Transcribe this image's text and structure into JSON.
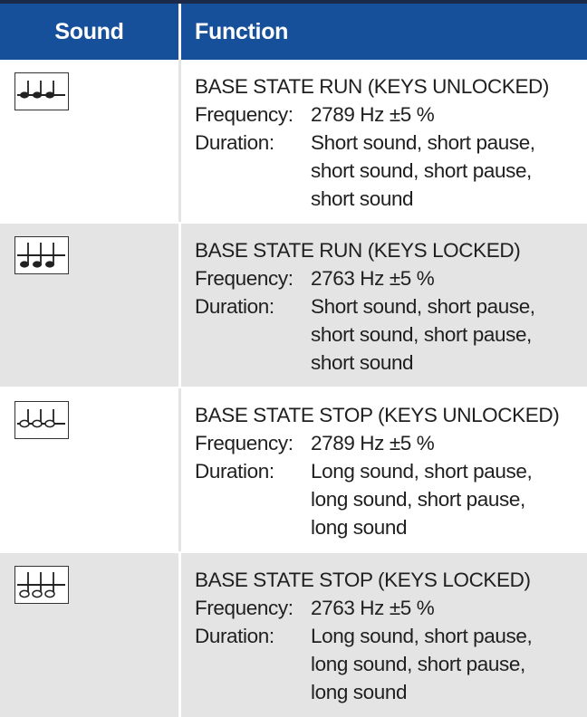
{
  "header": {
    "sound": "Sound",
    "function": "Function"
  },
  "rows": [
    {
      "icon": "three-filled-notes-above-icon",
      "title": "BASE STATE RUN (KEYS UNLOCKED)",
      "frequency_label": "Frequency:",
      "frequency_value": "2789 Hz ±5 %",
      "duration_label": "Duration:",
      "duration_lines": [
        "Short sound, short pause,",
        "short sound, short pause,",
        "short sound"
      ]
    },
    {
      "icon": "three-filled-notes-below-icon",
      "title": "BASE STATE RUN (KEYS LOCKED)",
      "frequency_label": "Frequency:",
      "frequency_value": "2763 Hz ±5 %",
      "duration_label": "Duration:",
      "duration_lines": [
        "Short sound, short pause,",
        "short sound, short pause,",
        "short sound"
      ]
    },
    {
      "icon": "three-hollow-notes-above-icon",
      "title": "BASE STATE STOP (KEYS UNLOCKED)",
      "frequency_label": "Frequency:",
      "frequency_value": "2789 Hz ±5 %",
      "duration_label": "Duration:",
      "duration_lines": [
        "Long sound, short pause,",
        "long sound, short pause,",
        "long sound"
      ]
    },
    {
      "icon": "three-hollow-notes-below-icon",
      "title": "BASE STATE STOP (KEYS LOCKED)",
      "frequency_label": "Frequency:",
      "frequency_value": "2763 Hz ±5 %",
      "duration_label": "Duration:",
      "duration_lines": [
        "Long sound, short pause,",
        "long sound, short pause,",
        "long sound"
      ]
    }
  ]
}
